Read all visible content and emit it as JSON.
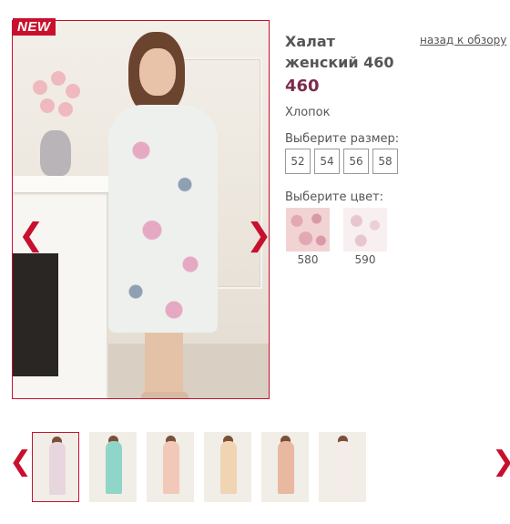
{
  "badge": "NEW",
  "product": {
    "title": "Халат женский 460",
    "back_link": "назад к обзору",
    "price": "460",
    "material": "Хлопок",
    "size_label": "Выберите размер:",
    "sizes": [
      "52",
      "54",
      "56",
      "58"
    ],
    "color_label": "Выберите цвет:",
    "colors": [
      {
        "code": "580",
        "swatch": "#f2d3d4"
      },
      {
        "code": "590",
        "swatch": "#f8eff0"
      }
    ]
  },
  "gallery": {
    "prev": "❮",
    "next": "❯",
    "thumb_prev": "❮",
    "thumb_next": "❯",
    "thumbnail_colors": [
      "#e8d6de",
      "#8fd6c8",
      "#f2c9b8",
      "#f0d4b4",
      "#e9b8a0",
      "#f4ece8"
    ]
  },
  "colors": {
    "accent": "#c8102e",
    "price": "#7b2c4e",
    "text": "#555555"
  }
}
